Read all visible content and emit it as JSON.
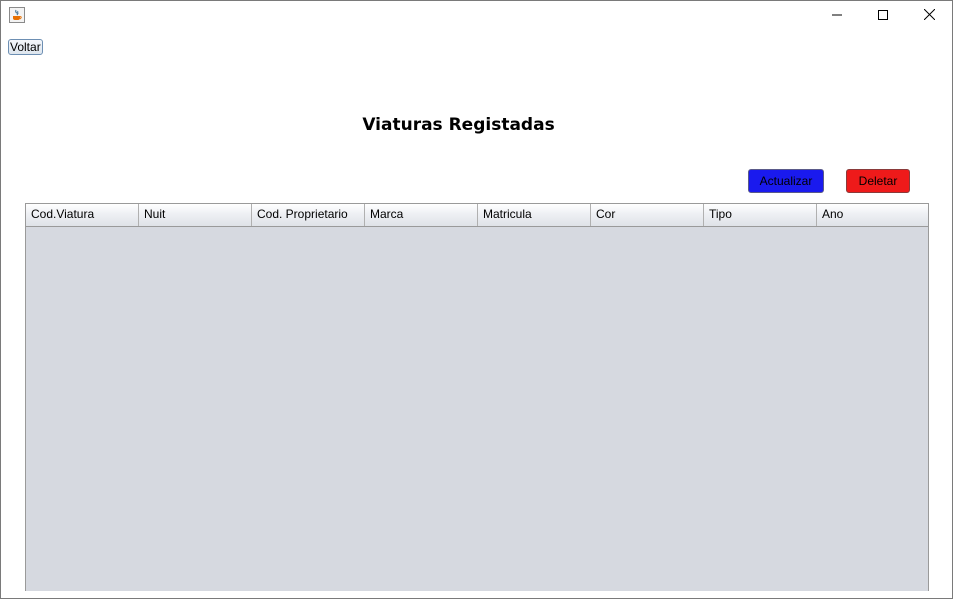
{
  "window": {
    "app_icon": "java-cup-icon",
    "controls": [
      "minimize-icon",
      "maximize-icon",
      "close-icon"
    ]
  },
  "toolbar": {
    "back_label": "Voltar"
  },
  "page": {
    "title": "Viaturas Registadas"
  },
  "actions": {
    "update_label": "Actualizar",
    "delete_label": "Deletar",
    "update_color": "#1a1aee",
    "delete_color": "#ee1a1a"
  },
  "table": {
    "columns": [
      "Cod.Viatura",
      "Nuit",
      "Cod. Proprietario",
      "Marca",
      "Matricula",
      "Cor",
      "Tipo",
      "Ano"
    ],
    "rows": []
  }
}
